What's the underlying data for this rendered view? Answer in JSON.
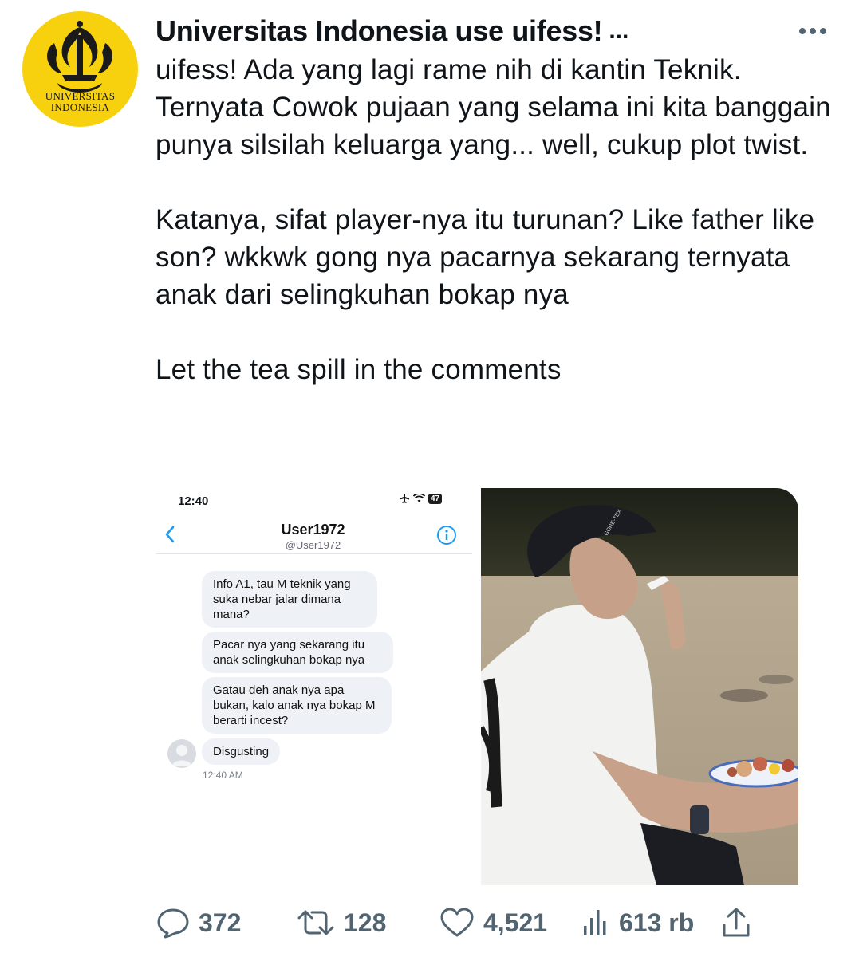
{
  "author": {
    "display_name": "Universitas Indonesia use uifess!",
    "name_ellipsis": "...",
    "avatar_text_line1": "UNIVERSITAS",
    "avatar_text_line2": "INDONESIA",
    "avatar_color": "#f7d10e"
  },
  "more_menu_icon": "more-horizontal-icon",
  "tweet": {
    "paragraphs": [
      "uifess! Ada yang lagi rame nih di kantin Teknik. Ternyata Cowok pujaan yang selama ini kita banggain punya silsilah keluarga yang... well, cukup plot twist.",
      "Katanya, sifat player-nya itu turunan? Like father like son? wkkwk gong nya pacarnya sekarang ternyata anak dari selingkuhan bokap nya",
      "Let the tea spill in the comments"
    ]
  },
  "screenshot": {
    "status_time": "12:40",
    "battery": "47",
    "dm_name": "User1972",
    "dm_handle": "@User1972",
    "messages": [
      "Info A1, tau M teknik yang suka nebar jalar dimana mana?",
      "Pacar nya yang sekarang itu anak selingkuhan bokap nya",
      "Gatau deh anak nya apa bukan, kalo anak nya bokap M berarti incest?",
      "Disgusting"
    ],
    "timestamp": "12:40 AM",
    "accent_color": "#1d9bf0"
  },
  "photo": {
    "cap_text": "GORE-TEX"
  },
  "actions": {
    "replies": "372",
    "retweets": "128",
    "likes": "4,521",
    "views": "613 rb",
    "icon_color": "#536471"
  }
}
